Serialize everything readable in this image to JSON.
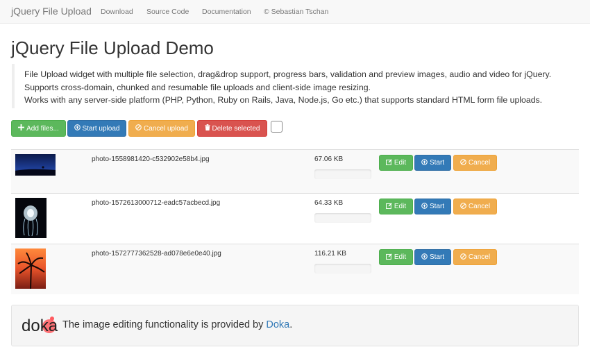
{
  "navbar": {
    "brand": "jQuery File Upload",
    "links": [
      "Download",
      "Source Code",
      "Documentation",
      "© Sebastian Tschan"
    ]
  },
  "page": {
    "title": "jQuery File Upload Demo",
    "lead": [
      "File Upload widget with multiple file selection, drag&drop support, progress bars, validation and preview images, audio and video for jQuery.",
      "Supports cross-domain, chunked and resumable file uploads and client-side image resizing.",
      "Works with any server-side platform (PHP, Python, Ruby on Rails, Java, Node.js, Go etc.) that supports standard HTML form file uploads."
    ]
  },
  "toolbar": {
    "add_files": "Add files...",
    "start_upload": "Start upload",
    "cancel_upload": "Cancel upload",
    "delete_selected": "Delete selected",
    "toggle_checked": false
  },
  "files": [
    {
      "name": "photo-1558981420-c532902e58b4.jpg",
      "size": "67.06 KB",
      "progress": 0
    },
    {
      "name": "photo-1572613000712-eadc57acbecd.jpg",
      "size": "64.33 KB",
      "progress": 0
    },
    {
      "name": "photo-1572777362528-ad078e6e0e40.jpg",
      "size": "116.21 KB",
      "progress": 0
    }
  ],
  "row_actions": {
    "edit": "Edit",
    "start": "Start",
    "cancel": "Cancel"
  },
  "credit": {
    "logo_text": "doka",
    "text": "The image editing functionality is provided by ",
    "link": "Doka",
    "suffix": "."
  },
  "icons": {
    "add": "plus-icon",
    "start": "upload-circle-icon",
    "cancel": "ban-icon",
    "delete": "trash-icon",
    "edit": "edit-icon"
  },
  "colors": {
    "success": "#5cb85c",
    "primary": "#337ab7",
    "warning": "#f0ad4e",
    "danger": "#d9534f",
    "doka_accent": "#ff5a5f"
  }
}
